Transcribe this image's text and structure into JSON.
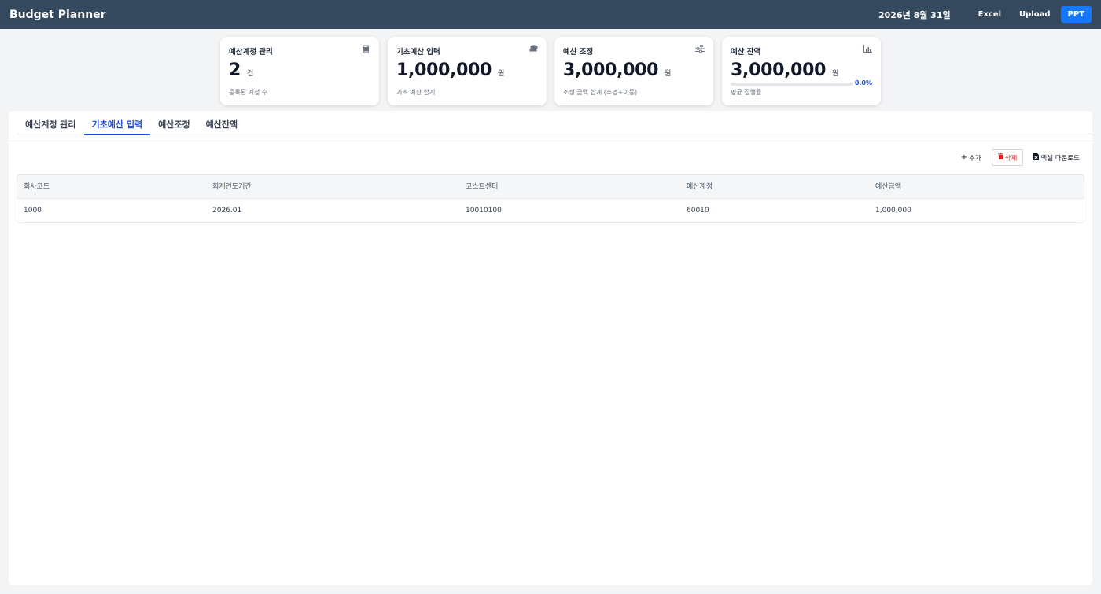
{
  "header": {
    "title": "Budget Planner",
    "date": "2026년 8월 31일",
    "buttons": {
      "excel": "Excel",
      "upload": "Upload",
      "ppt": "PPT"
    }
  },
  "cards": [
    {
      "title": "예산계정 관리",
      "value": "2",
      "unit": "건",
      "sub": "등록된 계정 수",
      "icon": "book-icon"
    },
    {
      "title": "기초예산 입력",
      "value": "1,000,000",
      "unit": "원",
      "sub": "기초 예산 합계",
      "icon": "coins-icon"
    },
    {
      "title": "예산 조정",
      "value": "3,000,000",
      "unit": "원",
      "sub": "조정 금액 합계 (추경+이동)",
      "icon": "sliders-icon"
    },
    {
      "title": "예산 잔액",
      "value": "3,000,000",
      "unit": "원",
      "sub": "평균 집행률",
      "icon": "chart-icon",
      "progress_label": "0.0%",
      "progress_fraction": 0.0
    }
  ],
  "tabs": [
    {
      "label": "예산계정 관리",
      "active": false
    },
    {
      "label": "기초예산 입력",
      "active": true
    },
    {
      "label": "예산조정",
      "active": false
    },
    {
      "label": "예산잔액",
      "active": false
    }
  ],
  "toolbar": {
    "add": "추가",
    "delete": "삭제",
    "download": "엑셀 다운로드"
  },
  "table": {
    "columns": [
      "회사코드",
      "회계연도기간",
      "코스트센터",
      "예산계정",
      "예산금액"
    ],
    "rows": [
      [
        "1000",
        "2026.01",
        "10010100",
        "60010",
        "1,000,000"
      ]
    ]
  },
  "colors": {
    "topbar": "#34495e",
    "primary": "#1677ff",
    "active_tab": "#1d4ed8",
    "danger": "#dc2626"
  }
}
